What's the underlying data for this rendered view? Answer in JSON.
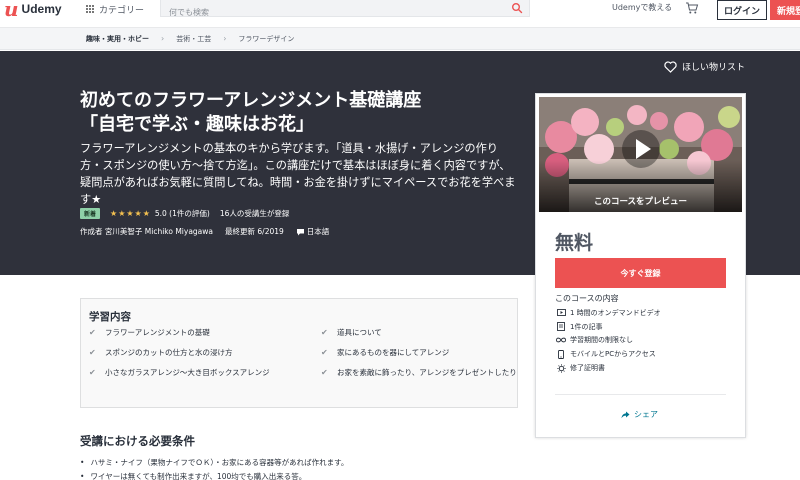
{
  "header": {
    "logo_mark": "u",
    "logo_text": "Udemy",
    "category_label": "カテゴリー",
    "search_placeholder": "何でも検索",
    "teach_label": "Udemyで教える",
    "login_label": "ログイン",
    "signup_label": "新規登録"
  },
  "breadcrumb": [
    "趣味・実用・ホビー",
    "芸術・工芸",
    "フラワーデザイン"
  ],
  "hero": {
    "wishlist_label": "ほしい物リスト",
    "title_line1": "初めてのフラワーアレンジメント基礎講座",
    "title_line2": "「自宅で学ぶ・趣味はお花」",
    "subtitle": "フラワーアレンジメントの基本のキから学びます。「道具・水揚げ・アレンジの作り方・スポンジの使い方～捨て方迄」。この講座だけで基本はほぼ身に着く内容ですが、疑問点があればお気軽に質問してね。時間・お金を掛けずにマイペースでお花を学べます★",
    "badge": "新着",
    "stars": "★★★★★",
    "rating_text": "5.0 (1件の評価)",
    "students": "16人の受講生が登録",
    "author": "作成者 宮川美智子 Michiko Miyagawa",
    "updated": "最終更新 6/2019",
    "language": "日本語"
  },
  "sidebar": {
    "preview_label": "このコースをプレビュー",
    "price": "無料",
    "enroll_label": "今すぐ登録",
    "includes_title": "このコースの内容",
    "includes": [
      {
        "icon": "video-icon",
        "text": "1 時間のオンデマンドビデオ"
      },
      {
        "icon": "article-icon",
        "text": "1件の記事"
      },
      {
        "icon": "infinity-icon",
        "text": "学習期間の制限なし"
      },
      {
        "icon": "mobile-icon",
        "text": "モバイルとPCからアクセス"
      },
      {
        "icon": "certificate-icon",
        "text": "修了証明書"
      }
    ],
    "share_label": "シェア"
  },
  "learn": {
    "title": "学習内容",
    "left": [
      "フラワーアレンジメントの基礎",
      "スポンジのカットの仕方と水の浸け方",
      "小さなガラスアレンジ～大き目ボックスアレンジ"
    ],
    "right": [
      "道具について",
      "家にあるものを器にしてアレンジ",
      "お家を素敵に飾ったり、アレンジをプレゼントしたり"
    ]
  },
  "requirements": {
    "title": "受講における必要条件",
    "items": [
      "ハサミ・ナイフ（果物ナイフでＯＫ）・お家にある容器等があれば作れます。",
      "ワイヤーは無くても制作出来ますが、100均でも購入出来る答。"
    ]
  },
  "colors": {
    "brand": "#ec5252",
    "hero_bg": "#2f313b",
    "star": "#f4c150",
    "link": "#007791"
  }
}
